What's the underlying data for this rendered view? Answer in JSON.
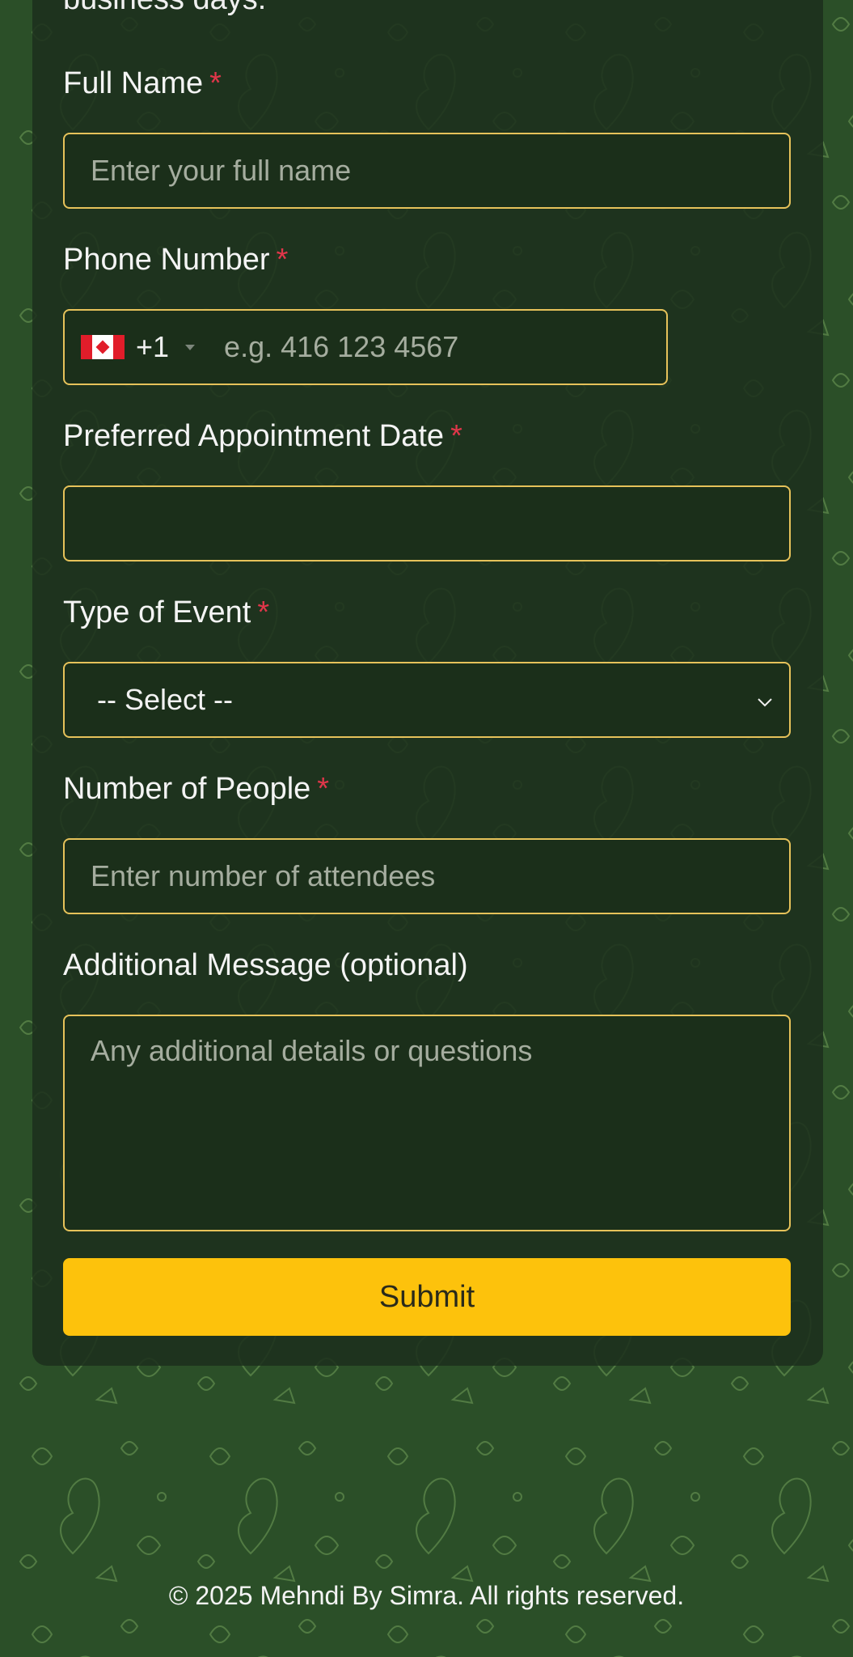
{
  "header_cut_text": "business days.",
  "form": {
    "full_name": {
      "label": "Full Name",
      "required_mark": "*",
      "placeholder": "Enter your full name"
    },
    "phone": {
      "label": "Phone Number",
      "required_mark": "*",
      "country_flag": "canada-flag-icon",
      "dial_code": "+1",
      "placeholder": "e.g. 416 123 4567"
    },
    "date": {
      "label": "Preferred Appointment Date",
      "required_mark": "*",
      "value": ""
    },
    "event_type": {
      "label": "Type of Event",
      "required_mark": "*",
      "selected": "-- Select --"
    },
    "people": {
      "label": "Number of People",
      "required_mark": "*",
      "placeholder": "Enter number of attendees"
    },
    "message": {
      "label": "Additional Message (optional)",
      "placeholder": "Any additional details or questions"
    },
    "submit_label": "Submit"
  },
  "footer": {
    "text": "© 2025 Mehndi By Simra. All rights reserved."
  },
  "colors": {
    "background": "#2b4f28",
    "card": "#1c301c",
    "input_border": "#e6c25a",
    "required": "#e0364a",
    "submit": "#fdc20c"
  }
}
